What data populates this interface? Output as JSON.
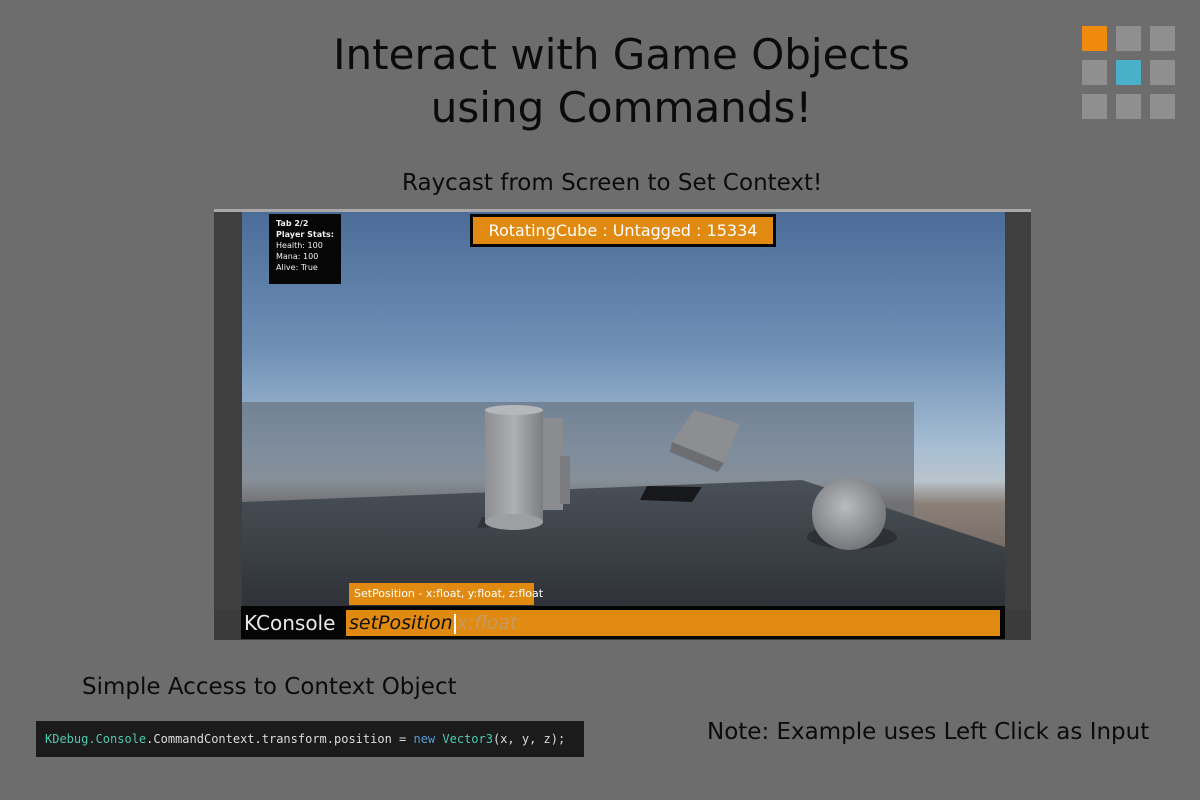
{
  "title": {
    "line1": "Interact with Game Objects",
    "line2": "using Commands!"
  },
  "logo": {
    "colors": [
      "#f08a0c",
      "#8f8f8f",
      "#8f8f8f",
      "#8f8f8f",
      "#4ab0c9",
      "#8f8f8f",
      "#8f8f8f",
      "#8f8f8f",
      "#8f8f8f"
    ]
  },
  "subtitle": "Raycast from Screen to Set Context!",
  "game_view": {
    "stats": {
      "tab": "Tab 2/2",
      "header": "Player Stats:",
      "health": "Health: 100",
      "mana": "Mana: 100",
      "alive": "Alive: True"
    },
    "context_label": "RotatingCube : Untagged : 15334",
    "command_hint": "SetPosition - x:float, y:float, z:float",
    "console": {
      "label": "KConsole",
      "typed": "setPosition",
      "suggestion": "x:float"
    }
  },
  "caption_context": "Simple Access to Context Object",
  "code": {
    "ns": "KDebug.Console",
    "dot": ".",
    "rest": "CommandContext.transform.position = ",
    "kw": "new",
    "cls": "Vector3",
    "args": "(x, y, z);"
  },
  "note": "Note: Example uses Left Click as Input",
  "colors": {
    "accent": "#e18a12",
    "background": "#6d6d6d"
  }
}
